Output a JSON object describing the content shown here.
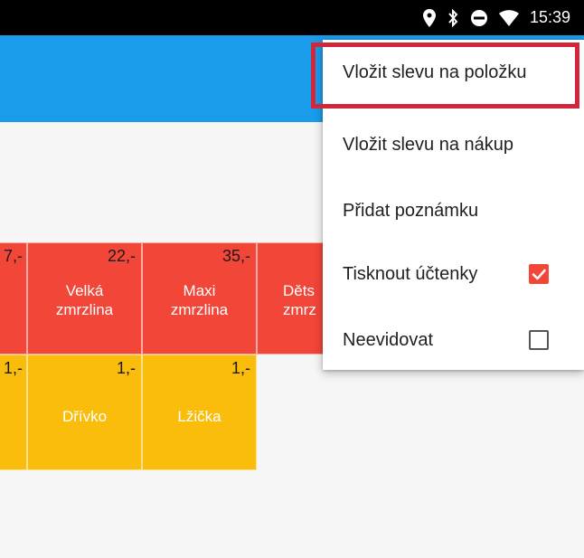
{
  "status_bar": {
    "time": "15:39",
    "icons": [
      "location-icon",
      "bluetooth-icon",
      "do-not-disturb-icon",
      "wifi-icon"
    ]
  },
  "colors": {
    "app_bar": "#1a9ceb",
    "tile_red": "#f24639",
    "tile_yellow": "#fbbd0b",
    "highlight": "#d3263a",
    "checkbox_checked": "#f24639"
  },
  "tiles_row1": [
    {
      "price": "7,-",
      "name": ""
    },
    {
      "price": "22,-",
      "name": "Velká zmrzlina"
    },
    {
      "price": "35,-",
      "name": "Maxi zmrzlina"
    },
    {
      "price": "",
      "name": "Děts zmrz"
    }
  ],
  "tiles_row2": [
    {
      "price": "1,-",
      "name": ""
    },
    {
      "price": "1,-",
      "name": "Dřívko"
    },
    {
      "price": "1,-",
      "name": "Lžička"
    }
  ],
  "menu": {
    "items": [
      {
        "label": "Vložit slevu na položku"
      },
      {
        "label": "Vložit slevu na nákup"
      },
      {
        "label": "Přidat poznámku"
      },
      {
        "label": "Tisknout účtenky",
        "checkbox": "checked"
      },
      {
        "label": "Neevidovat",
        "checkbox": "unchecked"
      }
    ]
  }
}
